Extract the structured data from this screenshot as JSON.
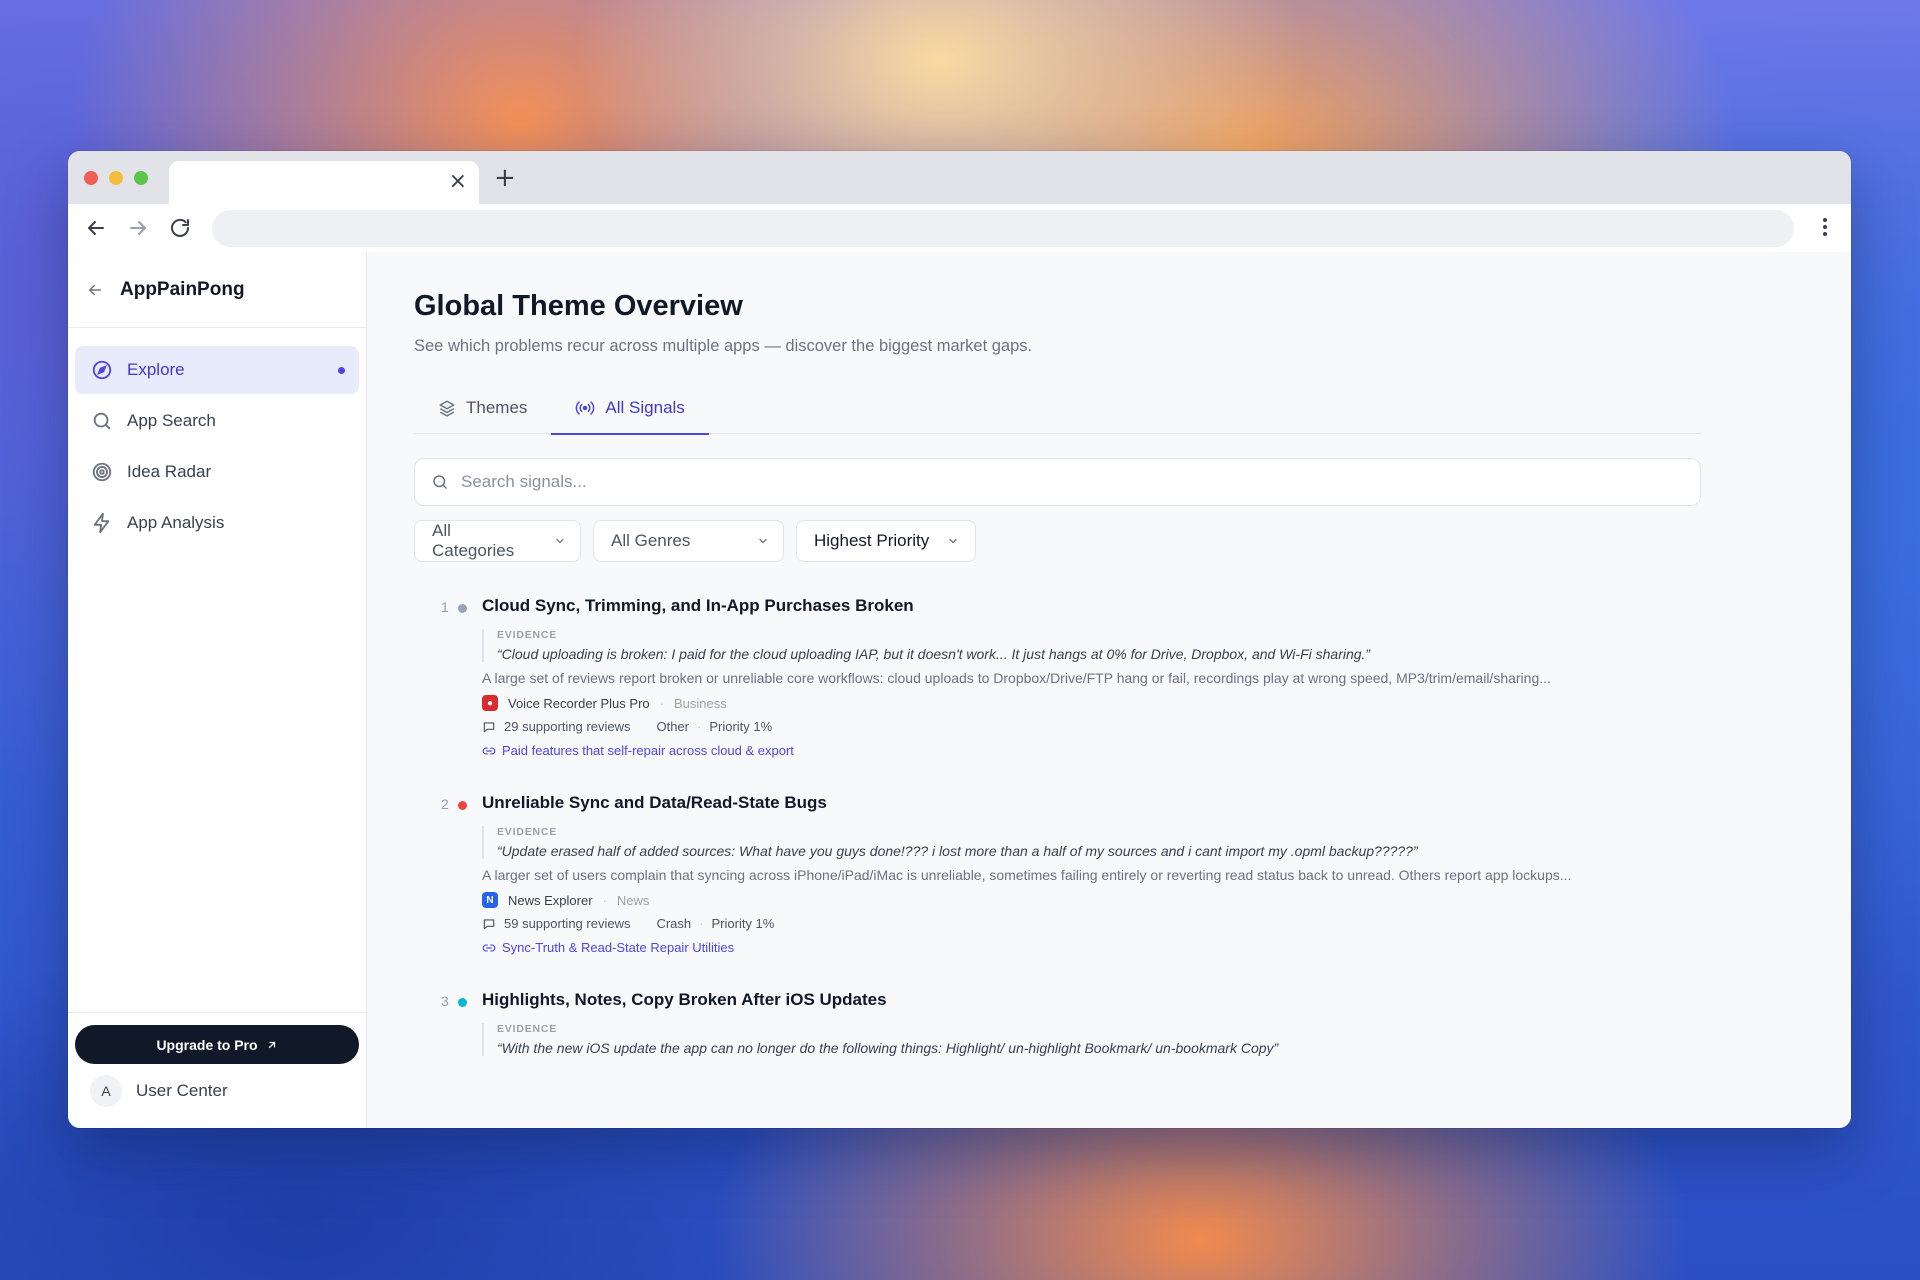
{
  "browser": {
    "tab_title": "",
    "tab_close_glyph": "×",
    "new_tab_glyph": "+",
    "url": ""
  },
  "sidebar": {
    "brand": "AppPainPong",
    "items": [
      {
        "label": "Explore",
        "icon": "compass-icon",
        "active": true
      },
      {
        "label": "App Search",
        "icon": "search-icon"
      },
      {
        "label": "Idea Radar",
        "icon": "radar-icon"
      },
      {
        "label": "App Analysis",
        "icon": "bolt-icon"
      }
    ],
    "upgrade_label": "Upgrade to Pro",
    "user_initial": "A",
    "user_center_label": "User Center"
  },
  "main": {
    "title": "Global Theme Overview",
    "subtitle": "See which problems recur across multiple apps — discover the biggest market gaps.",
    "tabs": [
      {
        "label": "Themes",
        "icon": "layers-icon"
      },
      {
        "label": "All Signals",
        "icon": "broadcast-icon",
        "active": true
      }
    ],
    "search_placeholder": "Search signals...",
    "filters": [
      "All Categories",
      "All Genres",
      "Highest Priority"
    ],
    "evidence_label": "EVIDENCE",
    "signals": [
      {
        "num": "1",
        "dot_color": "#94a3b8",
        "title": "Cloud Sync, Trimming, and In-App Purchases Broken",
        "quote": "“Cloud uploading is broken: I paid for the cloud uploading IAP, but it doesn't work... It just hangs at 0% for Drive, Dropbox, and Wi-Fi sharing.”",
        "desc": "A large set of reviews report broken or unreliable core workflows: cloud uploads to Dropbox/Drive/FTP hang or fail, recordings play at wrong speed, MP3/trim/email/sharing...",
        "app": "Voice Recorder Plus Pro",
        "app_icon_color": "#d92d2d",
        "genre": "Business",
        "reviews": "29 supporting reviews",
        "category": "Other",
        "priority": "Priority 1%",
        "link": "Paid features that self-repair across cloud & export"
      },
      {
        "num": "2",
        "dot_color": "#ef4444",
        "title": "Unreliable Sync and Data/Read-State Bugs",
        "quote": "“Update erased half of added sources: What have you guys done!??? i lost more than a half of my sources and i cant import my .opml backup?????”",
        "desc": "A larger set of users complain that syncing across iPhone/iPad/iMac is unreliable, sometimes failing entirely or reverting read status back to unread. Others report app lockups...",
        "app": "News Explorer",
        "app_icon_color": "#2563eb",
        "genre": "News",
        "reviews": "59 supporting reviews",
        "category": "Crash",
        "priority": "Priority 1%",
        "link": "Sync-Truth & Read-State Repair Utilities"
      },
      {
        "num": "3",
        "dot_color": "#06b6d4",
        "title": "Highlights, Notes, Copy Broken After iOS Updates",
        "quote": "“With the new iOS update the app can no longer do the following things: Highlight/ un-highlight Bookmark/ un-bookmark Copy”",
        "desc": "",
        "app": "",
        "genre": "",
        "reviews": "",
        "category": "",
        "priority": "",
        "link": ""
      }
    ]
  }
}
